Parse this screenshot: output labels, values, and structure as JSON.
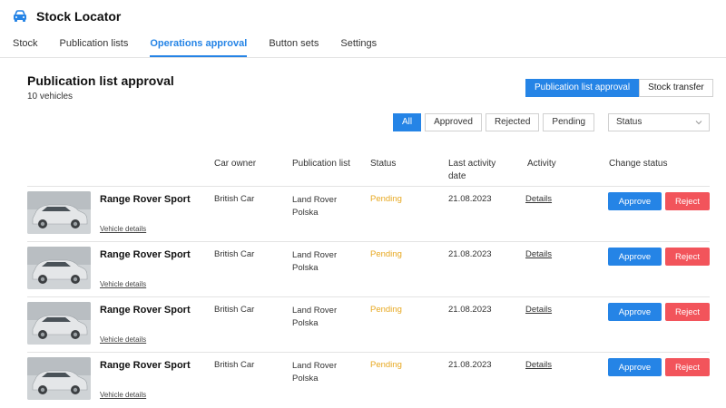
{
  "app": {
    "title": "Stock Locator",
    "icon": "car-icon",
    "accent": "#2584e6"
  },
  "nav": {
    "tabs": [
      {
        "label": "Stock"
      },
      {
        "label": "Publication lists"
      },
      {
        "label": "Operations approval",
        "active": true
      },
      {
        "label": "Button sets"
      },
      {
        "label": "Settings"
      }
    ]
  },
  "page": {
    "title": "Publication list approval",
    "subtitle": "10 vehicles"
  },
  "segment": {
    "primary": "Publication list approval",
    "secondary": "Stock transfer"
  },
  "filters": {
    "all": "All",
    "approved": "Approved",
    "rejected": "Rejected",
    "pending": "Pending",
    "status_placeholder": "Status"
  },
  "table": {
    "headers": {
      "owner": "Car owner",
      "list": "Publication list",
      "status": "Status",
      "last_activity": "Last activity date",
      "activity": "Activity",
      "change": "Change status"
    },
    "rows": [
      {
        "model": "Range Rover Sport",
        "vehicle_link": "Vehicle details",
        "owner": "British Car",
        "list": "Land Rover Polska",
        "status": "Pending",
        "date": "21.08.2023",
        "details": "Details",
        "approve": "Approve",
        "reject": "Reject"
      },
      {
        "model": "Range Rover Sport",
        "vehicle_link": "Vehicle details",
        "owner": "British Car",
        "list": "Land Rover Polska",
        "status": "Pending",
        "date": "21.08.2023",
        "details": "Details",
        "approve": "Approve",
        "reject": "Reject"
      },
      {
        "model": "Range Rover Sport",
        "vehicle_link": "Vehicle details",
        "owner": "British Car",
        "list": "Land Rover Polska",
        "status": "Pending",
        "date": "21.08.2023",
        "details": "Details",
        "approve": "Approve",
        "reject": "Reject"
      },
      {
        "model": "Range Rover Sport",
        "vehicle_link": "Vehicle details",
        "owner": "British Car",
        "list": "Land Rover Polska",
        "status": "Pending",
        "date": "21.08.2023",
        "details": "Details",
        "approve": "Approve",
        "reject": "Reject"
      }
    ]
  },
  "colors": {
    "pending": "#e7a820",
    "reject": "#f2545b",
    "approve": "#2584e6"
  }
}
